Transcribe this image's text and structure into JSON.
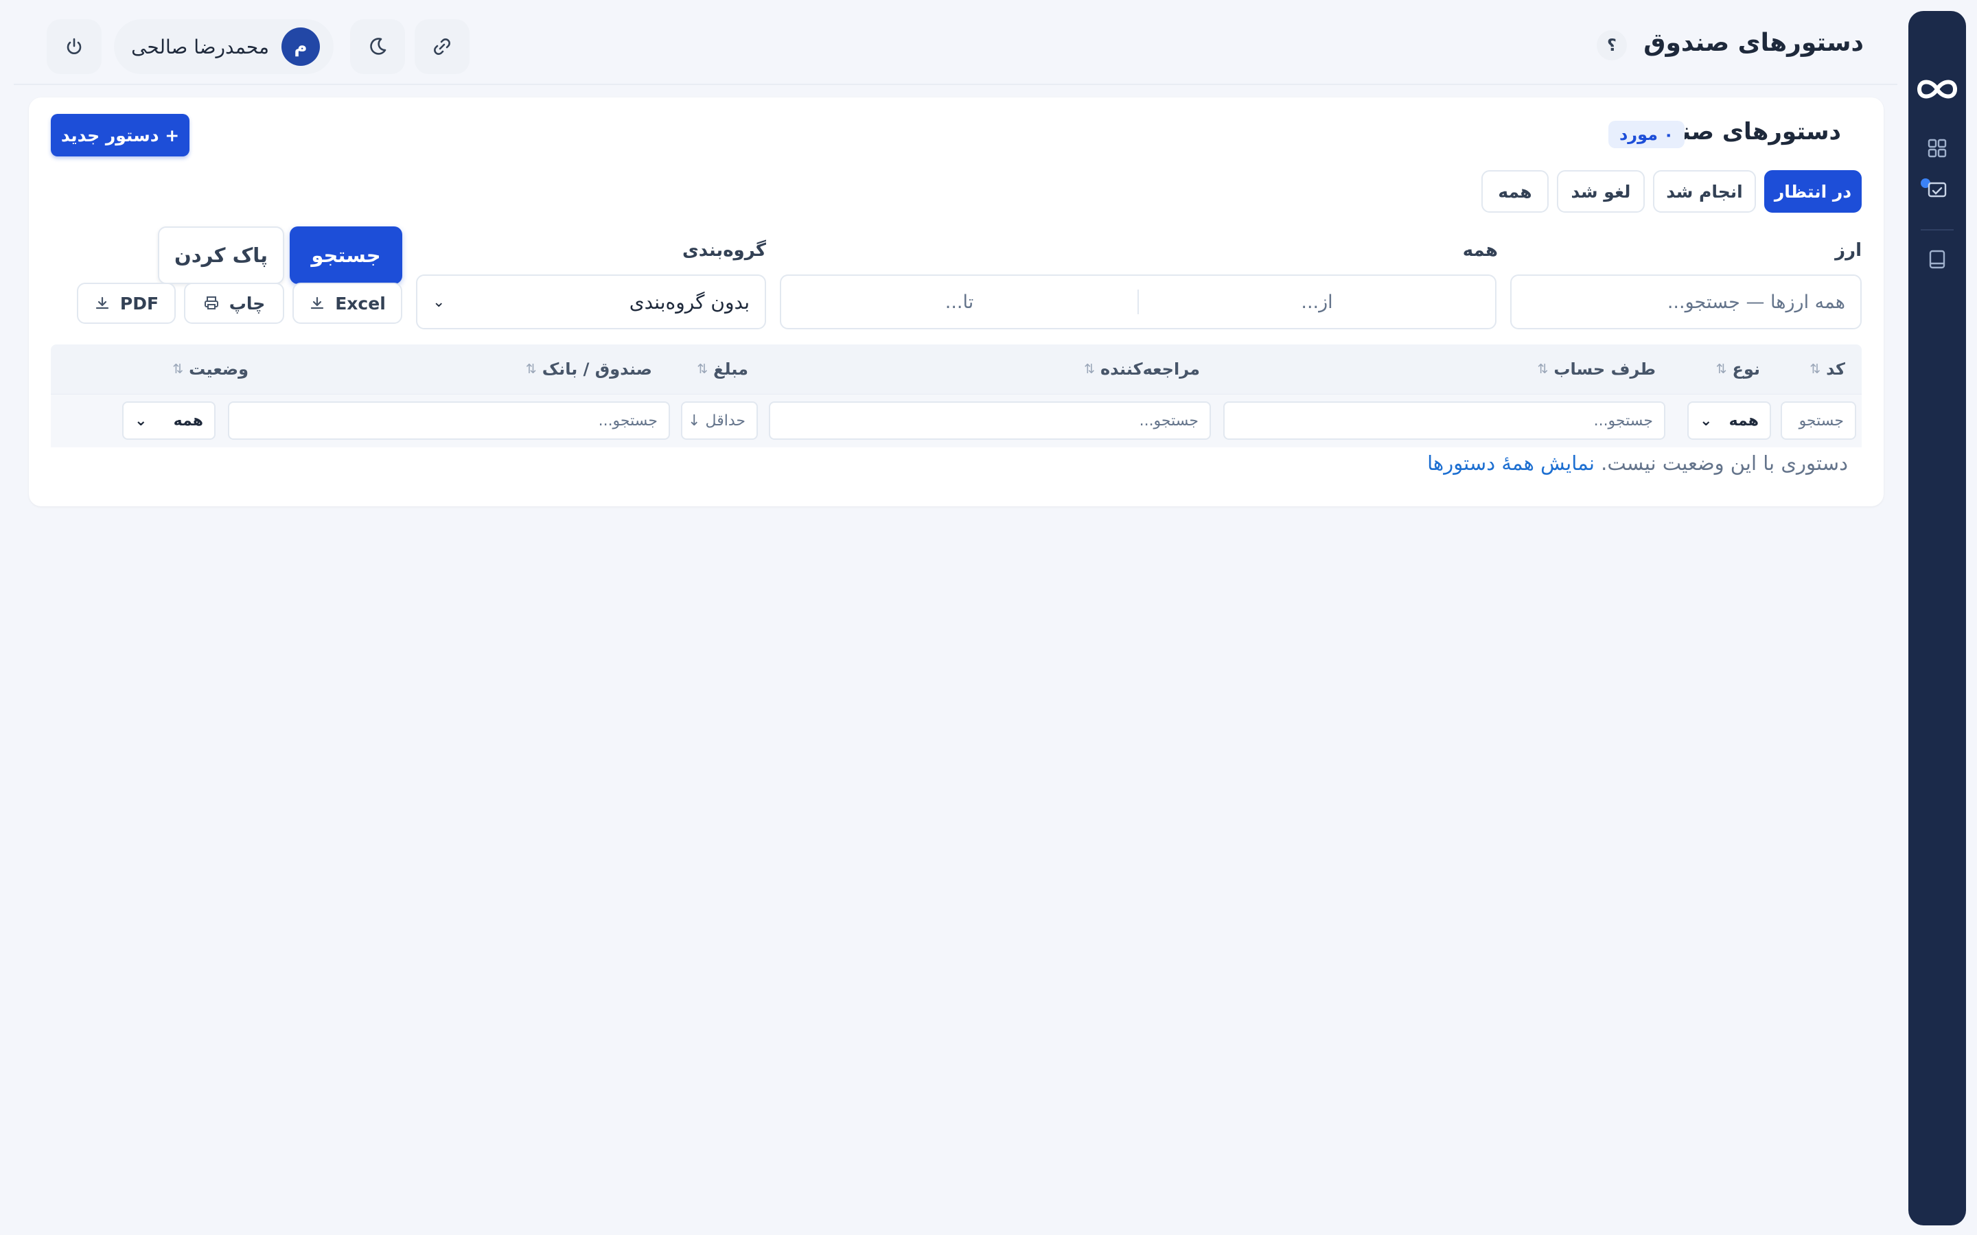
{
  "header": {
    "page_title": "دستورهای صندوق",
    "help_label": "؟",
    "user": {
      "avatar_initial": "م",
      "name": "محمدرضا صالحی"
    }
  },
  "card": {
    "title": "دستورهای صندوق",
    "count_badge": "۰ مورد",
    "new_button": "+ دستور جدید",
    "tabs": [
      {
        "label": "در انتظار",
        "active": true
      },
      {
        "label": "انجام شد",
        "active": false
      },
      {
        "label": "لغو شد",
        "active": false
      },
      {
        "label": "همه",
        "active": false
      }
    ],
    "filters": {
      "currency_label": "ارز",
      "currency_placeholder": "همه ارزها — جستجو...",
      "range_label": "همه",
      "from_placeholder": "از...",
      "to_placeholder": "تا...",
      "grouping_label": "گروه‌بندی",
      "grouping_value": "بدون گروه‌بندی",
      "search_button": "جستجو",
      "clear_button": "پاک کردن",
      "export_excel": "Excel",
      "export_print": "چاپ",
      "export_pdf": "PDF"
    },
    "table": {
      "columns": [
        "کد",
        "نوع",
        "طرف حساب",
        "مراجعه‌کننده",
        "مبلغ",
        "صندوق / بانک",
        "وضعیت"
      ],
      "column_filters": {
        "code": "جستجو",
        "type": "همه",
        "counterparty": "جستجو...",
        "referrer": "جستجو...",
        "amount_min": "حداقل ↓",
        "fund_bank": "جستجو...",
        "status": "همه"
      }
    },
    "empty_message": "دستوری با این وضعیت نیست.",
    "empty_link": "نمایش همهٔ دستورها"
  },
  "colors": {
    "primary": "#1d4ed8",
    "sidebar": "#1b2a4a",
    "background": "#f4f6fb"
  }
}
